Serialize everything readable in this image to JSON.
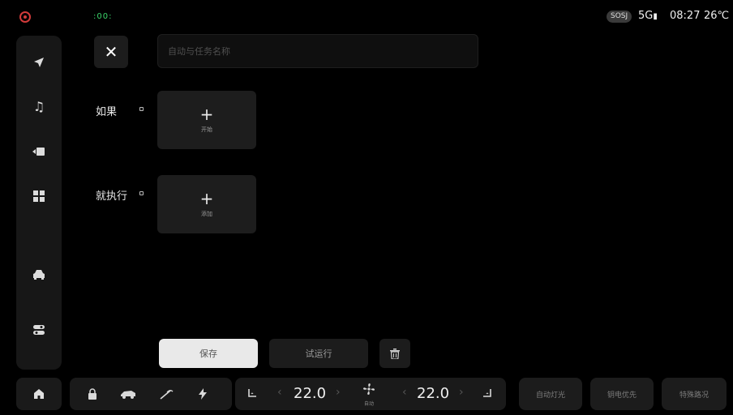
{
  "status_bar": {
    "left_indicator": ":00:",
    "sos_label": "SOSJ",
    "network": "5G",
    "time": "08:27",
    "temperature": "26℃"
  },
  "sidebar": {
    "items": [
      {
        "name": "navigation-icon",
        "glyph": "➤"
      },
      {
        "name": "music-icon",
        "glyph": "♫"
      },
      {
        "name": "video-icon",
        "glyph": "▶"
      },
      {
        "name": "apps-icon",
        "glyph": "▦"
      },
      {
        "name": "car-icon",
        "glyph": "⛟"
      },
      {
        "name": "toggle-settings-icon",
        "glyph": "☰"
      }
    ]
  },
  "editor": {
    "name_placeholder": "自动与任务名称",
    "if_label": "如果",
    "then_label": "就执行",
    "if_card_caption": "开始",
    "then_card_caption": "添加",
    "plus": "+"
  },
  "actions": {
    "save_label": "保存",
    "test_label": "试运行",
    "delete_glyph": "🗑"
  },
  "dock": {
    "left_temp": "22.0",
    "right_temp": "22.0",
    "fan_caption": "自动",
    "pills": [
      "自动灯光",
      "钥电优先",
      "特殊路况"
    ]
  }
}
